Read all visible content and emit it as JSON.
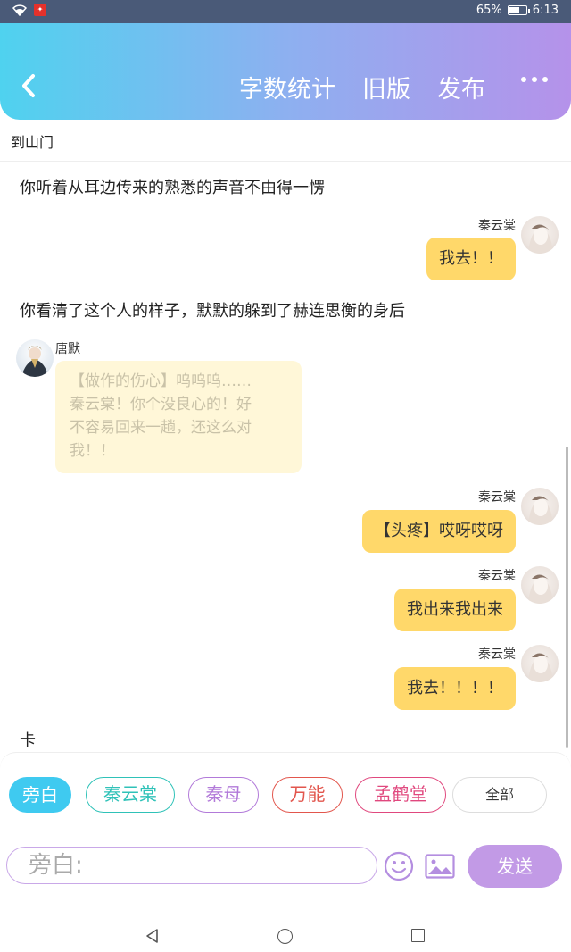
{
  "status_bar": {
    "battery": "65%",
    "time": "6:13",
    "battery_level": 0.65
  },
  "header": {
    "actions": [
      "字数统计",
      "旧版",
      "发布"
    ]
  },
  "chapter_title": "到山门",
  "messages": [
    {
      "type": "narration",
      "text": "你听着从耳边传来的熟悉的声音不由得一愣"
    },
    {
      "type": "right",
      "speaker": "秦云棠",
      "text": "我去！！"
    },
    {
      "type": "narration",
      "text": "你看清了这个人的样子，默默的躲到了赫连思衡的身后"
    },
    {
      "type": "left",
      "speaker": "唐默",
      "lines": [
        "【做作的伤心】呜呜呜……",
        "秦云棠！你个没良心的！好",
        "不容易回来一趟，还这么对",
        "我！！"
      ]
    },
    {
      "type": "right",
      "speaker": "秦云棠",
      "text": "【头疼】哎呀哎呀"
    },
    {
      "type": "right",
      "speaker": "秦云棠",
      "text": "我出来我出来"
    },
    {
      "type": "right",
      "speaker": "秦云棠",
      "text": "我去！！！！"
    },
    {
      "type": "narration",
      "text": "卡"
    }
  ],
  "roles": [
    {
      "label": "旁白",
      "color": "#3fcaf0",
      "active": true
    },
    {
      "label": "秦云棠",
      "color": "#2fc2b8",
      "active": false
    },
    {
      "label": "秦母",
      "color": "#b27ad9",
      "active": false
    },
    {
      "label": "万能",
      "color": "#e2564d",
      "active": false
    },
    {
      "label": "孟鹤堂",
      "color": "#e0487e",
      "active": false
    },
    {
      "label": "全部",
      "color": "#dddddd",
      "active": false
    }
  ],
  "composer": {
    "placeholder": "旁白:",
    "send_label": "发送"
  },
  "colors": {
    "bubble": "#ffd86a",
    "bubble_dim": "#fff7d8",
    "accent": "#c29ae6"
  },
  "icons": [
    "back-chevron-icon",
    "more-dots-icon",
    "emoji-icon",
    "image-icon",
    "wifi-icon",
    "battery-icon"
  ]
}
